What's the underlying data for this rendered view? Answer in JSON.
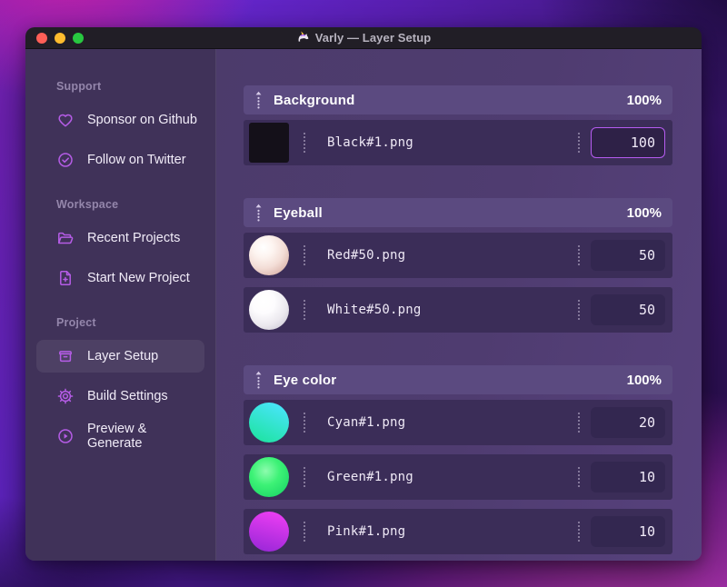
{
  "app": {
    "title": "Varly — Layer Setup",
    "icon": "unicorn-icon"
  },
  "titlebar_buttons": [
    {
      "name": "close-button"
    },
    {
      "name": "minimize-button"
    },
    {
      "name": "zoom-button"
    }
  ],
  "sidebar": {
    "sections": [
      {
        "label": "Support",
        "items": [
          {
            "icon": "heart-icon",
            "label": "Sponsor on Github",
            "selected": false
          },
          {
            "icon": "badge-check-icon",
            "label": "Follow on Twitter",
            "selected": false
          }
        ]
      },
      {
        "label": "Workspace",
        "items": [
          {
            "icon": "folder-icon",
            "label": "Recent Projects",
            "selected": false
          },
          {
            "icon": "file-plus-icon",
            "label": "Start New Project",
            "selected": false
          }
        ]
      },
      {
        "label": "Project",
        "items": [
          {
            "icon": "archive-icon",
            "label": "Layer Setup",
            "selected": true
          },
          {
            "icon": "gear-icon",
            "label": "Build Settings",
            "selected": false
          },
          {
            "icon": "play-circle-icon",
            "label": "Preview & Generate",
            "selected": false
          }
        ]
      }
    ]
  },
  "layer_groups": [
    {
      "name": "Background",
      "weight": "100%",
      "rows": [
        {
          "thumb": "black-square",
          "file": "Black#1.png",
          "value": "100",
          "focused": true
        }
      ]
    },
    {
      "name": "Eyeball",
      "weight": "100%",
      "rows": [
        {
          "thumb": "red-sphere",
          "file": "Red#50.png",
          "value": "50",
          "focused": false
        },
        {
          "thumb": "white-sphere",
          "file": "White#50.png",
          "value": "50",
          "focused": false
        }
      ]
    },
    {
      "name": "Eye color",
      "weight": "100%",
      "rows": [
        {
          "thumb": "cyan-circle",
          "file": "Cyan#1.png",
          "value": "20",
          "focused": false
        },
        {
          "thumb": "green-circle",
          "file": "Green#1.png",
          "value": "10",
          "focused": false
        },
        {
          "thumb": "pink-circle",
          "file": "Pink#1.png",
          "value": "10",
          "focused": false
        }
      ]
    }
  ],
  "colors": {
    "accent": "#b55ce6",
    "focus_border": "#b55cf0",
    "traffic_red": "#ff5f57",
    "traffic_yellow": "#febc2e",
    "traffic_green": "#28c840",
    "thumb_cyan_top": "#49e5fb",
    "thumb_cyan_bottom": "#1fe3a2",
    "thumb_green_top": "#3df276",
    "thumb_green_bottom": "#12cf62",
    "thumb_pink_top": "#e93df2",
    "thumb_pink_bottom": "#9a27d8"
  }
}
